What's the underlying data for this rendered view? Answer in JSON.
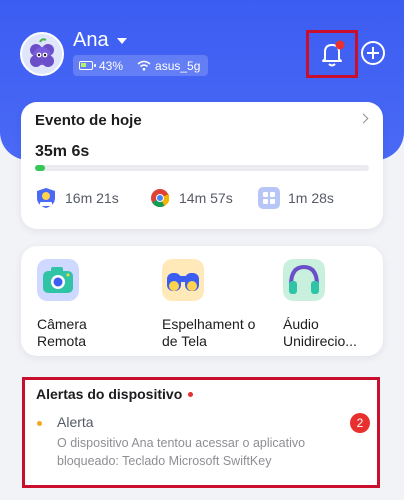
{
  "header": {
    "user_name": "Ana",
    "battery": "43%",
    "wifi": "asus_5g",
    "accent": "#3c5df2"
  },
  "today_card": {
    "title": "Evento de hoje",
    "total": "35m 6s",
    "progress_fraction": 0.03,
    "apps": [
      {
        "icon": "kids-shield-icon",
        "time": "16m 21s"
      },
      {
        "icon": "chrome-icon",
        "time": "14m 57s"
      },
      {
        "icon": "app-grid-icon",
        "time": "1m 28s"
      }
    ]
  },
  "features": [
    {
      "icon": "camera-icon",
      "label": "Câmera Remota"
    },
    {
      "icon": "binoculars-icon",
      "label": "Espelhament o de Tela"
    },
    {
      "icon": "headphones-icon",
      "label": "Áudio Unidirecio..."
    }
  ],
  "alerts": {
    "title": "Alertas do dispositivo",
    "item_title": "Alerta",
    "item_text": "O dispositivo Ana tentou acessar o aplicativo bloqueado: Teclado Microsoft SwiftKey",
    "count": "2"
  }
}
